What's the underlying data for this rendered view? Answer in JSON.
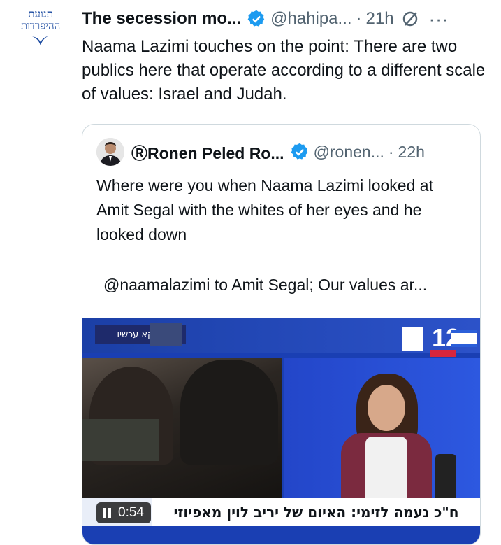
{
  "tweet": {
    "avatar_text_line1": "תנועת",
    "avatar_text_line2": "ההיפרדות",
    "display_name": "The secession mo...",
    "handle": "@hahipa...",
    "separator": "·",
    "time": "21h",
    "text": "Naama Lazimi touches on the point: There are two publics here that operate according to a different scale of values: Israel and Judah.",
    "more_label": "···"
  },
  "quote": {
    "display_name": "ⓇRonen Peled Ro...",
    "handle": "@ronen...",
    "separator": "·",
    "time": "22h",
    "text": "Where were you when Naama Lazimi looked at Amit Segal with the whites of her eyes and he looked down",
    "subtext": "@naamalazimi to Amit Segal; Our values ar..."
  },
  "video": {
    "live_badge": "ודוקא עכשיו",
    "channel_logo": "12",
    "caption": "ח\"כ נעמה לזימי: האיום של יריב לוין מאפיוזי",
    "duration": "0:54"
  },
  "colors": {
    "verified_blue": "#1d9bf0",
    "text": "#0f1419",
    "muted": "#536471",
    "border": "#cfd9de"
  }
}
